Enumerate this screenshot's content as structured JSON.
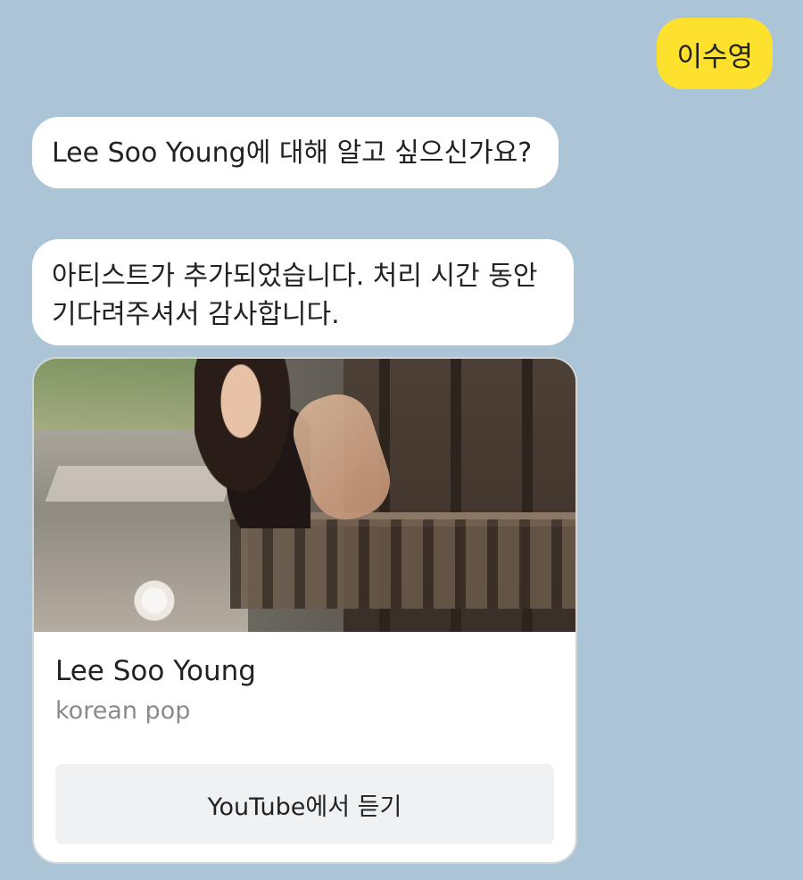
{
  "user_message": "이수영",
  "bot_messages": [
    "Lee Soo Young에 대해 알고 싶으신가요?",
    "아티스트가 추가되었습니다. 처리 시간 동안 기다려주셔서 감사합니다."
  ],
  "artist_card": {
    "name": "Lee Soo Young",
    "genre": "korean pop",
    "button_label": "YouTube에서 듣기",
    "photo_subject": "artist-photo"
  },
  "colors": {
    "background": "#abc5d7",
    "user_bubble": "#fde12c",
    "bot_bubble": "#ffffff",
    "button_bg": "#eff1f3"
  }
}
